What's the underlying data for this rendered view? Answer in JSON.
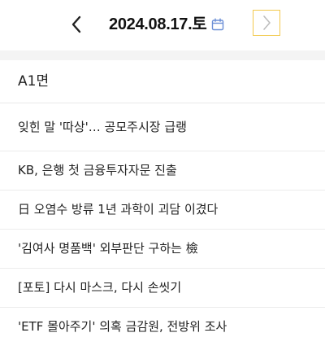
{
  "header": {
    "date": "2024.08.17.토",
    "icons": {
      "prev": "chevron-left-icon",
      "calendar": "calendar-icon",
      "next": "chevron-right-icon"
    },
    "accent_color": "#f2c94c",
    "calendar_color": "#6b8fd6"
  },
  "section": {
    "title": "A1면"
  },
  "articles": [
    {
      "headline": "잊힌 말 '따상'… 공모주시장 급랭"
    },
    {
      "headline": "KB, 은행 첫 금융투자자문 진출"
    },
    {
      "headline": "日 오염수 방류 1년 과학이 괴담 이겼다"
    },
    {
      "headline": "'김여사 명품백' 외부판단 구하는 檢"
    },
    {
      "headline": "[포토] 다시 마스크, 다시 손씻기"
    },
    {
      "headline": "'ETF 몰아주기' 의혹 금감원, 전방위 조사"
    }
  ]
}
